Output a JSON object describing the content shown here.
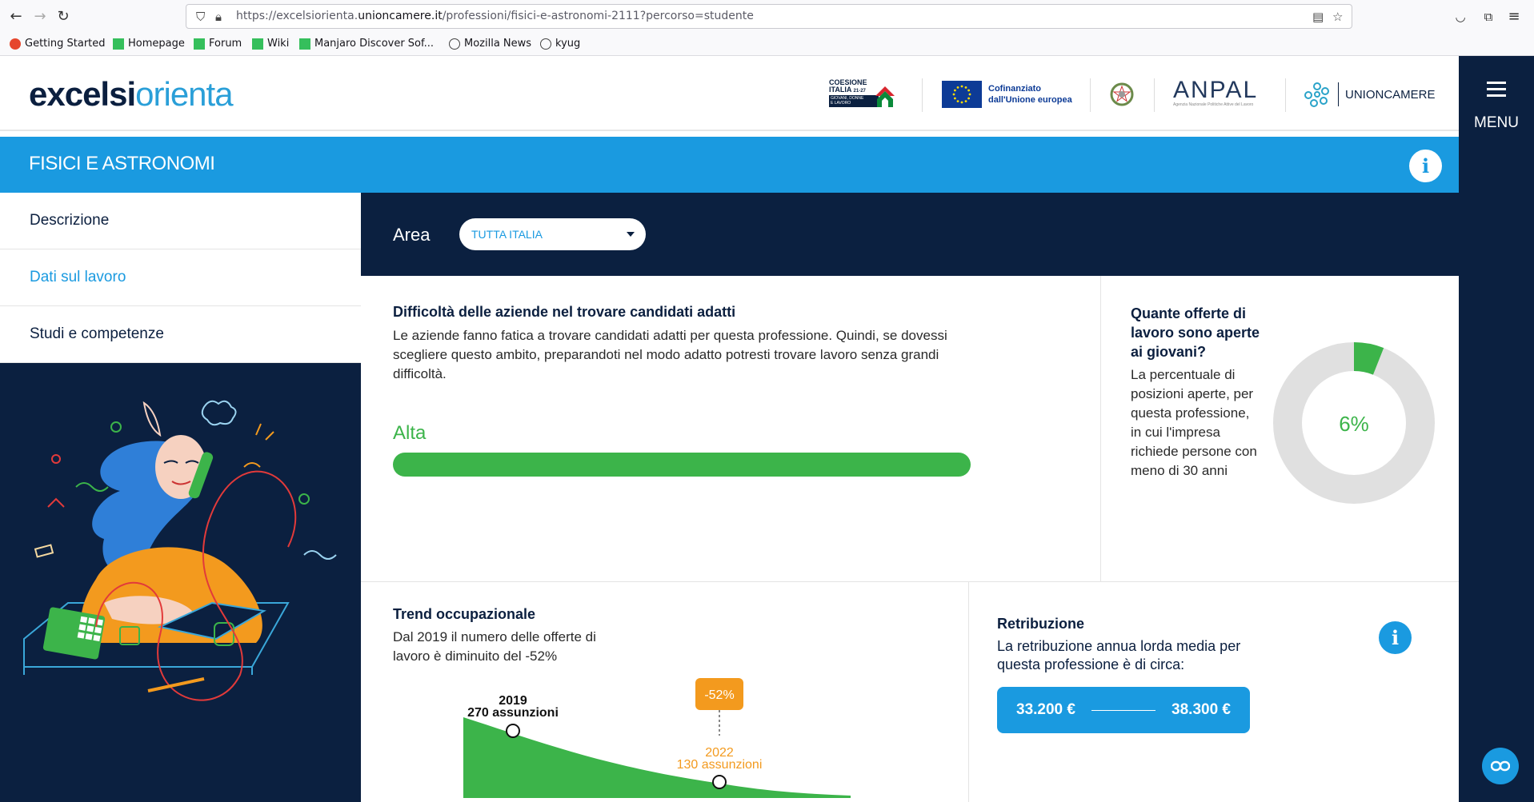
{
  "browser": {
    "url_prefix": "https://excelsiorienta.",
    "url_domain": "unioncamere.it",
    "url_suffix": "/professioni/fisici-e-astronomi-2111?percorso=studente",
    "bookmarks": [
      "Getting Started",
      "Homepage",
      "Forum",
      "Wiki",
      "Manjaro Discover Sof...",
      "Mozilla News",
      "kyug"
    ]
  },
  "header": {
    "logo_part1": "excelsi",
    "logo_part2": "orienta",
    "partner_coesione_line1": "COESIONE",
    "partner_coesione_line2": "ITALIA",
    "partner_coesione_sup": "21-27",
    "partner_coesione_line3": "GIOVANI, DONNE",
    "partner_coesione_line4": "E LAVORO",
    "partner_eu_line1": "Cofinanziato",
    "partner_eu_line2": "dall'Unione europea",
    "partner_anpal": "ANPAL",
    "partner_anpal_sub": "Agenzia Nazionale Politiche Attive del Lavoro",
    "partner_unioncamere": "UNIONCAMERE"
  },
  "menu": {
    "label": "MENU",
    "chat_icon": "link-icon"
  },
  "title": "FISICI E ASTRONOMI",
  "sidebar": {
    "items": [
      {
        "label": "Descrizione",
        "active": false
      },
      {
        "label": "Dati sul lavoro",
        "active": true
      },
      {
        "label": "Studi e competenze",
        "active": false
      }
    ]
  },
  "area": {
    "label": "Area",
    "selected": "TUTTA ITALIA"
  },
  "difficulty": {
    "title": "Difficoltà delle aziende nel trovare candidati adatti",
    "text": "Le aziende fanno fatica a trovare candidati adatti per questa professione. Quindi, se dovessi scegliere questo ambito, preparandoti nel modo adatto potresti trovare lavoro senza grandi difficoltà.",
    "level": "Alta",
    "level_fraction": 1.0,
    "color": "#3cb44a"
  },
  "youth": {
    "title": "Quante offerte di lavoro sono aperte ai giovani?",
    "text": "La percentuale di posizioni aperte, per questa professione, in cui l'impresa richiede persone con meno di 30 anni",
    "percent": 6,
    "percent_label": "6%"
  },
  "trend": {
    "title": "Trend occupazionale",
    "text": "Dal 2019 il numero delle offerte di lavoro è diminuito del -52%",
    "badge": "-52%",
    "start_year": "2019",
    "start_label": "270 assunzioni",
    "end_year": "2022",
    "end_label": "130 assunzioni"
  },
  "salary": {
    "title": "Retribuzione",
    "text": "La retribuzione annua lorda media per questa professione è di circa:",
    "low": "33.200 €",
    "high": "38.300 €"
  },
  "colors": {
    "navy": "#0b2040",
    "blue": "#1a9ae0",
    "green": "#3cb44a",
    "orange": "#f39a1e"
  }
}
